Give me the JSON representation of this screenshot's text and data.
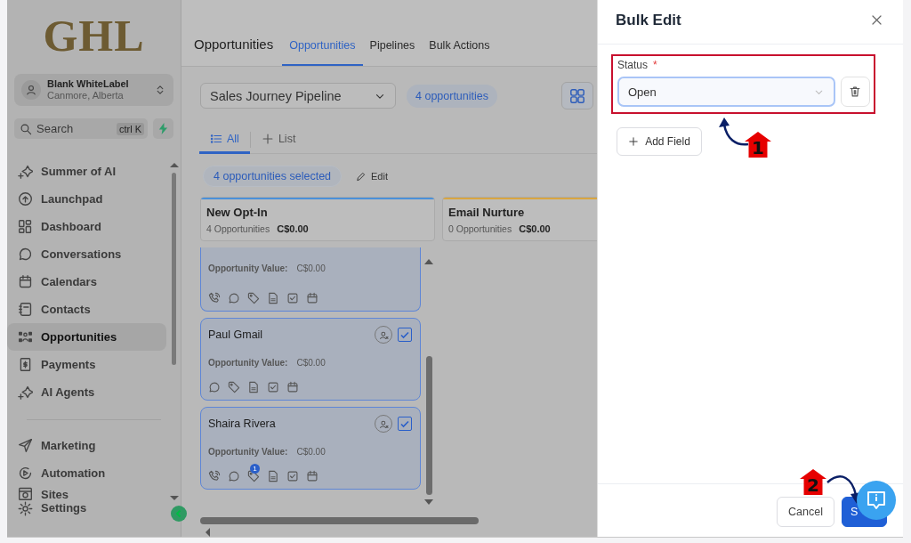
{
  "sidebar": {
    "logo": "GHL",
    "account": {
      "name": "Blank WhiteLabel",
      "location": "Canmore, Alberta"
    },
    "search": {
      "placeholder": "Search",
      "shortcut": "ctrl K"
    },
    "items": [
      {
        "label": "Summer of AI",
        "kind": "sparkle",
        "selected": false
      },
      {
        "label": "Launchpad",
        "kind": "rocket",
        "selected": false
      },
      {
        "label": "Dashboard",
        "kind": "grid",
        "selected": false
      },
      {
        "label": "Conversations",
        "kind": "chat",
        "selected": false
      },
      {
        "label": "Calendars",
        "kind": "calendar",
        "selected": false
      },
      {
        "label": "Contacts",
        "kind": "contacts",
        "selected": false
      },
      {
        "label": "Opportunities",
        "kind": "opportunities",
        "selected": true
      },
      {
        "label": "Payments",
        "kind": "payments",
        "selected": false
      },
      {
        "label": "AI Agents",
        "kind": "sparkle",
        "selected": false
      }
    ],
    "bottom_items": [
      {
        "label": "Marketing",
        "kind": "send",
        "selected": false
      },
      {
        "label": "Automation",
        "kind": "automation",
        "selected": false
      },
      {
        "label": "Sites",
        "kind": "sites",
        "selected": false
      },
      {
        "label": "Settings",
        "kind": "gear",
        "selected": false
      }
    ]
  },
  "header": {
    "title": "Opportunities",
    "tabs": [
      {
        "label": "Opportunities",
        "selected": true
      },
      {
        "label": "Pipelines",
        "selected": false
      },
      {
        "label": "Bulk Actions",
        "selected": false
      }
    ]
  },
  "toolbar": {
    "pipeline": "Sales Journey Pipeline",
    "count": "4 opportunities"
  },
  "views": [
    {
      "label": "All",
      "kind": "list",
      "selected": true
    },
    {
      "label": "List",
      "kind": "add",
      "selected": false
    }
  ],
  "selection": {
    "label": "4 opportunities selected",
    "edit": "Edit"
  },
  "stages": [
    {
      "name": "New Opt-In",
      "count": "4 Opportunities",
      "value": "C$0.00",
      "color": "#4a90d9",
      "cards": [
        {
          "value_label": "Opportunity Value:",
          "value": "C$0.00",
          "icons": [
            {
              "kind": "phone"
            },
            {
              "kind": "chat"
            },
            {
              "kind": "tag"
            },
            {
              "kind": "note"
            },
            {
              "kind": "task"
            },
            {
              "kind": "calendar"
            }
          ]
        },
        {
          "name": "Paul Gmail",
          "checked": true,
          "value_label": "Opportunity Value:",
          "value": "C$0.00",
          "icons": [
            {
              "kind": "chat"
            },
            {
              "kind": "tag"
            },
            {
              "kind": "note"
            },
            {
              "kind": "task"
            },
            {
              "kind": "calendar"
            }
          ]
        },
        {
          "name": "Shaira Rivera",
          "checked": true,
          "value_label": "Opportunity Value:",
          "value": "C$0.00",
          "icons": [
            {
              "kind": "phone"
            },
            {
              "kind": "chat"
            },
            {
              "kind": "tag",
              "badge": "1"
            },
            {
              "kind": "note"
            },
            {
              "kind": "task"
            },
            {
              "kind": "calendar"
            }
          ]
        }
      ]
    },
    {
      "name": "Email Nurture",
      "count": "0 Opportunities",
      "value": "C$0.00",
      "color": "#d9a640"
    }
  ],
  "drawer": {
    "title": "Bulk Edit",
    "fields": [
      {
        "label": "Status",
        "required": true,
        "required_mark": "*",
        "value": "Open"
      }
    ],
    "add_field": "Add Field",
    "buttons": [
      {
        "label": "Cancel",
        "kind": "secondary"
      },
      {
        "label": "S",
        "kind": "primary"
      }
    ]
  },
  "annotations": [
    {
      "label": "1"
    },
    {
      "label": "2"
    }
  ]
}
